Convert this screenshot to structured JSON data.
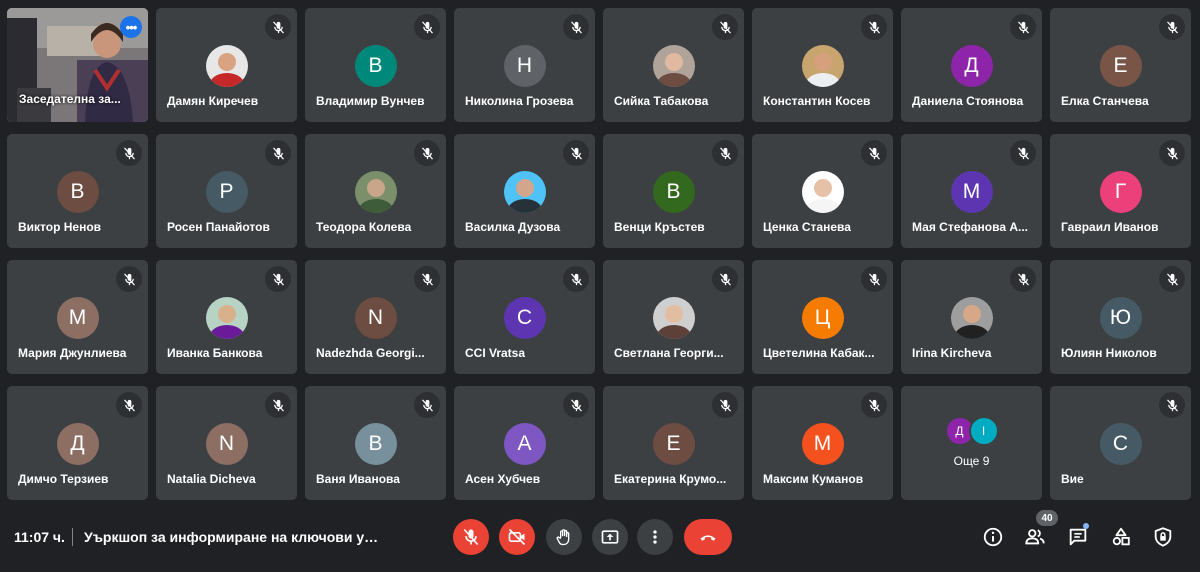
{
  "self_view": {
    "name": "Заседателна за...",
    "menu_icon": "more-horiz-icon"
  },
  "tiles": [
    {
      "name": "Дамян Киречев",
      "avatar": {
        "kind": "photo",
        "skin": "#d9a382",
        "shirt": "#c62828",
        "bg": "#e7e7e7"
      }
    },
    {
      "name": "Владимир Вунчев",
      "avatar": {
        "kind": "letter",
        "letter": "В",
        "color": "#00897b"
      }
    },
    {
      "name": "Николина Грозева",
      "avatar": {
        "kind": "letter",
        "letter": "Н",
        "color": "#5f6368"
      }
    },
    {
      "name": "Сийка Табакова",
      "avatar": {
        "kind": "photo",
        "skin": "#e0b9a0",
        "shirt": "#6d4c41",
        "bg": "#b0a49a"
      }
    },
    {
      "name": "Константин Косев",
      "avatar": {
        "kind": "photo",
        "skin": "#d7a07c",
        "shirt": "#eceff1",
        "bg": "#c8a56e"
      }
    },
    {
      "name": "Даниела Стоянова",
      "avatar": {
        "kind": "letter",
        "letter": "Д",
        "color": "#8e24aa"
      }
    },
    {
      "name": "Елка Станчева",
      "avatar": {
        "kind": "letter",
        "letter": "Е",
        "color": "#795548"
      }
    },
    {
      "name": "Виктор Ненов",
      "avatar": {
        "kind": "letter",
        "letter": "В",
        "color": "#6d4c41"
      }
    },
    {
      "name": "Росен Панайотов",
      "avatar": {
        "kind": "letter",
        "letter": "Р",
        "color": "#455a64"
      }
    },
    {
      "name": "Теодора Колева",
      "avatar": {
        "kind": "photo",
        "skin": "#c9a58a",
        "shirt": "#3e5b3a",
        "bg": "#7a8f6a"
      }
    },
    {
      "name": "Василка Дузова",
      "avatar": {
        "kind": "photo",
        "skin": "#d1a68c",
        "shirt": "#263238",
        "bg": "#4fc3f7"
      }
    },
    {
      "name": "Венци Кръстев",
      "avatar": {
        "kind": "letter",
        "letter": "В",
        "color": "#33691e"
      }
    },
    {
      "name": "Ценка Станева",
      "avatar": {
        "kind": "photo",
        "skin": "#e7c1a6",
        "shirt": "#f5f5f5",
        "bg": "#ffffff"
      }
    },
    {
      "name": "Мая Стефанова А...",
      "avatar": {
        "kind": "letter",
        "letter": "М",
        "color": "#5e35b1"
      }
    },
    {
      "name": "Гавраил Иванов",
      "avatar": {
        "kind": "letter",
        "letter": "Г",
        "color": "#ec407a"
      }
    },
    {
      "name": "Мария Джунлиева",
      "avatar": {
        "kind": "letter",
        "letter": "М",
        "color": "#8d6e63"
      }
    },
    {
      "name": "Иванка Банкова",
      "avatar": {
        "kind": "photo",
        "skin": "#d9b08c",
        "shirt": "#6a1b9a",
        "bg": "#b7d3c4"
      }
    },
    {
      "name": "Nadezhda Georgi...",
      "avatar": {
        "kind": "letter",
        "letter": "N",
        "color": "#6d4c41"
      }
    },
    {
      "name": "CCI Vratsa",
      "avatar": {
        "kind": "letter",
        "letter": "C",
        "color": "#5e35b1"
      }
    },
    {
      "name": "Светлана Георги...",
      "avatar": {
        "kind": "photo",
        "skin": "#e3bda2",
        "shirt": "#5d4037",
        "bg": "#cfcfcf"
      }
    },
    {
      "name": "Цветелина Кабак...",
      "avatar": {
        "kind": "letter",
        "letter": "Ц",
        "color": "#f57c00"
      }
    },
    {
      "name": "Irina Kircheva",
      "avatar": {
        "kind": "photo",
        "skin": "#d6a887",
        "shirt": "#212121",
        "bg": "#9e9e9e"
      }
    },
    {
      "name": "Юлиян Николов",
      "avatar": {
        "kind": "letter",
        "letter": "Ю",
        "color": "#455a64"
      }
    },
    {
      "name": "Димчо Терзиев",
      "avatar": {
        "kind": "letter",
        "letter": "Д",
        "color": "#8d6e63"
      }
    },
    {
      "name": "Natalia Dicheva",
      "avatar": {
        "kind": "letter",
        "letter": "N",
        "color": "#8d6e63"
      }
    },
    {
      "name": "Ваня Иванова",
      "avatar": {
        "kind": "letter",
        "letter": "В",
        "color": "#78909c"
      }
    },
    {
      "name": "Асен Хубчев",
      "avatar": {
        "kind": "letter",
        "letter": "А",
        "color": "#7e57c2"
      }
    },
    {
      "name": "Екатерина Крумо...",
      "avatar": {
        "kind": "letter",
        "letter": "Е",
        "color": "#6d4c41"
      }
    },
    {
      "name": "Максим Куманов",
      "avatar": {
        "kind": "letter",
        "letter": "М",
        "color": "#f4511e"
      }
    },
    {
      "kind": "more",
      "label": "Още 9",
      "avatars": [
        {
          "letter": "Д",
          "color": "#8e24aa"
        },
        {
          "letter": "I",
          "color": "#00acc1"
        }
      ]
    },
    {
      "name": "Вие",
      "avatar": {
        "kind": "letter",
        "letter": "С",
        "color": "#455a64"
      }
    }
  ],
  "bottom_bar": {
    "time": "11:07 ч.",
    "meeting_title": "Уъркшоп за информиране на ключови уча...",
    "controls": [
      {
        "name": "mic-off-button",
        "icon": "mic-off-icon",
        "style": "red"
      },
      {
        "name": "camera-off-button",
        "icon": "camera-off-icon",
        "style": "red"
      },
      {
        "name": "raise-hand-button",
        "icon": "hand-icon",
        "style": "gray"
      },
      {
        "name": "present-button",
        "icon": "present-icon",
        "style": "gray"
      },
      {
        "name": "more-options-button",
        "icon": "more-vert-icon",
        "style": "gray"
      },
      {
        "name": "leave-call-button",
        "icon": "phone-hangup-icon",
        "style": "end"
      }
    ],
    "right_icons": [
      {
        "name": "meeting-details-button",
        "icon": "info-icon"
      },
      {
        "name": "people-button",
        "icon": "people-icon",
        "badge": "40"
      },
      {
        "name": "chat-button",
        "icon": "chat-icon",
        "dot": true
      },
      {
        "name": "activities-button",
        "icon": "activities-icon"
      },
      {
        "name": "host-controls-button",
        "icon": "lock-shield-icon"
      }
    ]
  }
}
